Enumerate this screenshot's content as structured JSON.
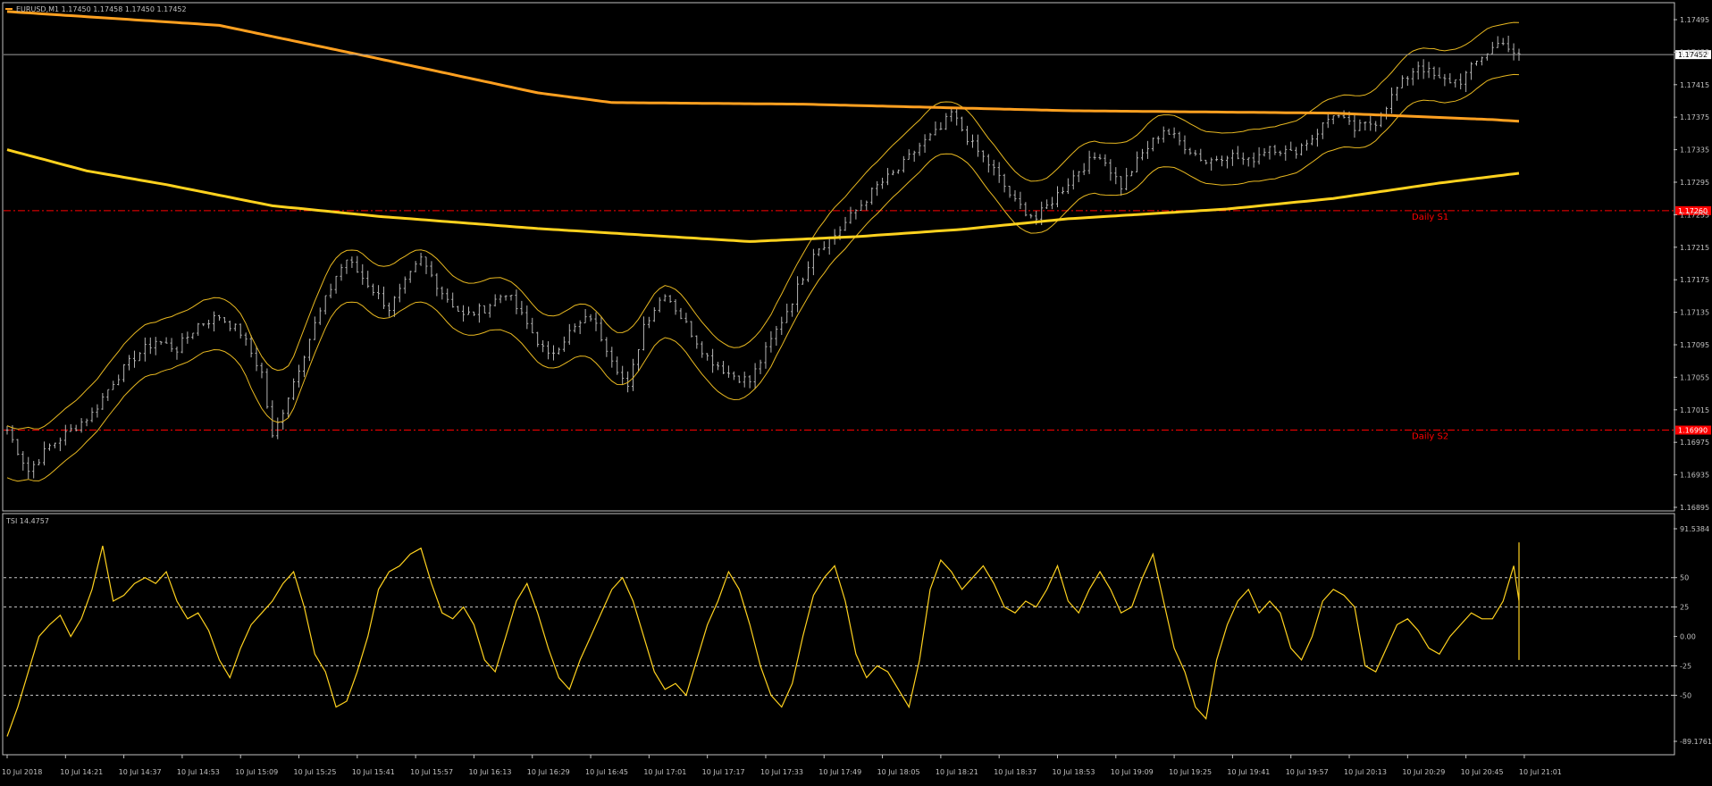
{
  "window": {
    "symbol_info": "EURUSD,M1  1.17450 1.17458 1.17450 1.17452"
  },
  "colors": {
    "background": "#000000",
    "frame": "#c0c0c0",
    "bars": "#b4b4b4",
    "envelope": "#e8b820",
    "ma_upper": "#ffa020",
    "ma_lower": "#ffd21e",
    "pivot": "#ff0000",
    "tsi": "#ffd21e",
    "grid_dash": "#c8c8c8",
    "text": "#c0c0c0"
  },
  "chart_data": [
    {
      "type": "line",
      "chart": "price",
      "title": "EURUSD,M1  1.17450 1.17458 1.17450 1.17452",
      "y_ticks": [
        "1.17495",
        "1.17455",
        "1.17415",
        "1.17375",
        "1.17335",
        "1.17295",
        "1.17255",
        "1.17215",
        "1.17175",
        "1.17135",
        "1.17095",
        "1.17055",
        "1.17015",
        "1.16975",
        "1.16935",
        "1.16895"
      ],
      "ylim": [
        1.16895,
        1.17495
      ],
      "x_ticks": [
        "10 Jul 2018",
        "10 Jul 14:21",
        "10 Jul 14:37",
        "10 Jul 14:53",
        "10 Jul 15:09",
        "10 Jul 15:25",
        "10 Jul 15:41",
        "10 Jul 15:57",
        "10 Jul 16:13",
        "10 Jul 16:29",
        "10 Jul 16:45",
        "10 Jul 17:01",
        "10 Jul 17:17",
        "10 Jul 17:33",
        "10 Jul 17:49",
        "10 Jul 18:05",
        "10 Jul 18:21",
        "10 Jul 18:37",
        "10 Jul 18:53",
        "10 Jul 19:09",
        "10 Jul 19:25",
        "10 Jul 19:41",
        "10 Jul 19:57",
        "10 Jul 20:13",
        "10 Jul 20:29",
        "10 Jul 20:45",
        "10 Jul 21:01"
      ],
      "current_price": {
        "label": "1.17452",
        "value": 1.17452
      },
      "pivots": [
        {
          "name": "Daily S1",
          "value": 1.1726,
          "label": "1.17260"
        },
        {
          "name": "Daily S2",
          "value": 1.1699,
          "label": "1.16990"
        }
      ],
      "close_points": [
        [
          0,
          1.1699
        ],
        [
          4,
          1.1694
        ],
        [
          8,
          1.1697
        ],
        [
          12,
          1.1699
        ],
        [
          16,
          1.1701
        ],
        [
          20,
          1.1705
        ],
        [
          24,
          1.1708
        ],
        [
          28,
          1.171
        ],
        [
          32,
          1.1709
        ],
        [
          36,
          1.1712
        ],
        [
          40,
          1.1713
        ],
        [
          44,
          1.1711
        ],
        [
          48,
          1.1706
        ],
        [
          50,
          1.1698
        ],
        [
          54,
          1.1705
        ],
        [
          58,
          1.1712
        ],
        [
          62,
          1.1718
        ],
        [
          64,
          1.172
        ],
        [
          68,
          1.1717
        ],
        [
          72,
          1.1714
        ],
        [
          76,
          1.1718
        ],
        [
          78,
          1.172
        ],
        [
          82,
          1.1716
        ],
        [
          86,
          1.1713
        ],
        [
          90,
          1.1714
        ],
        [
          94,
          1.1716
        ],
        [
          98,
          1.1712
        ],
        [
          102,
          1.1708
        ],
        [
          106,
          1.1711
        ],
        [
          110,
          1.1713
        ],
        [
          114,
          1.1708
        ],
        [
          117,
          1.1704
        ],
        [
          120,
          1.1712
        ],
        [
          124,
          1.1716
        ],
        [
          128,
          1.1712
        ],
        [
          132,
          1.1708
        ],
        [
          136,
          1.1706
        ],
        [
          140,
          1.1705
        ],
        [
          144,
          1.171
        ],
        [
          148,
          1.1715
        ],
        [
          152,
          1.1721
        ],
        [
          156,
          1.1723
        ],
        [
          160,
          1.1726
        ],
        [
          164,
          1.1729
        ],
        [
          168,
          1.1731
        ],
        [
          172,
          1.1734
        ],
        [
          176,
          1.1736
        ],
        [
          178,
          1.1738
        ],
        [
          182,
          1.1734
        ],
        [
          186,
          1.1731
        ],
        [
          190,
          1.1727
        ],
        [
          194,
          1.1725
        ],
        [
          198,
          1.1728
        ],
        [
          202,
          1.1731
        ],
        [
          206,
          1.1733
        ],
        [
          210,
          1.1729
        ],
        [
          214,
          1.1733
        ],
        [
          218,
          1.1736
        ],
        [
          222,
          1.1734
        ],
        [
          226,
          1.1732
        ],
        [
          230,
          1.1733
        ],
        [
          234,
          1.1732
        ],
        [
          238,
          1.1734
        ],
        [
          242,
          1.1733
        ],
        [
          246,
          1.1735
        ],
        [
          250,
          1.1738
        ],
        [
          254,
          1.1736
        ],
        [
          258,
          1.1737
        ],
        [
          262,
          1.1741
        ],
        [
          266,
          1.1744
        ],
        [
          270,
          1.1742
        ],
        [
          274,
          1.1742
        ],
        [
          278,
          1.1745
        ],
        [
          282,
          1.1747
        ],
        [
          284,
          1.1745
        ]
      ],
      "envelope_offset": 0.00032,
      "series": [
        {
          "type": "line",
          "points": [
            [
              0,
              1.17505
            ],
            [
              40,
              1.17488
            ],
            [
              70,
              1.17447
            ],
            [
              100,
              1.17405
            ],
            [
              114,
              1.17393
            ],
            [
              150,
              1.17391
            ],
            [
              200,
              1.17383
            ],
            [
              250,
              1.1738
            ],
            [
              280,
              1.17372
            ],
            [
              285,
              1.1737
            ]
          ]
        },
        {
          "type": "line",
          "points": [
            [
              0,
              1.17335
            ],
            [
              15,
              1.17309
            ],
            [
              30,
              1.17292
            ],
            [
              50,
              1.17266
            ],
            [
              70,
              1.17253
            ],
            [
              100,
              1.17238
            ],
            [
              125,
              1.17228
            ],
            [
              140,
              1.17222
            ],
            [
              160,
              1.17228
            ],
            [
              180,
              1.17237
            ],
            [
              200,
              1.1725
            ],
            [
              230,
              1.17262
            ],
            [
              250,
              1.17275
            ],
            [
              270,
              1.17294
            ],
            [
              285,
              1.17306
            ]
          ]
        },
        {
          "type": "line",
          "name": "TSI",
          "values_sampled_every_2_bars": [
            -85,
            -60,
            -30,
            0,
            10,
            18,
            0,
            15,
            40,
            77,
            30,
            35,
            45,
            50,
            45,
            55,
            30,
            15,
            20,
            5,
            -20,
            -35,
            -10,
            10,
            20,
            30,
            45,
            55,
            25,
            -15,
            -30,
            -60,
            -55,
            -30,
            0,
            40,
            55,
            60,
            70,
            75,
            45,
            20,
            15,
            25,
            10,
            -20,
            -30,
            0,
            30,
            45,
            20,
            -10,
            -35,
            -45,
            -20,
            0,
            20,
            40,
            50,
            30,
            0,
            -30,
            -45,
            -40,
            -50,
            -20,
            10,
            30,
            55,
            40,
            10,
            -25,
            -50,
            -60,
            -40,
            0,
            35,
            50,
            60,
            30,
            -15,
            -35,
            -25,
            -30,
            -45,
            -60,
            -20,
            40,
            65,
            55,
            40,
            50,
            60,
            45,
            25,
            20,
            30,
            25,
            40,
            60,
            30,
            20,
            40,
            55,
            40,
            20,
            25,
            50,
            70,
            30,
            -10,
            -30,
            -60,
            -70,
            -20,
            10,
            30,
            40,
            20,
            30,
            20,
            -10,
            -20,
            0,
            30,
            40,
            35,
            25,
            -25,
            -30,
            -10,
            10,
            15,
            5,
            -10,
            -15,
            0,
            10,
            20,
            15,
            15,
            30,
            60,
            30,
            0,
            -10,
            -20,
            -5,
            20,
            40,
            55,
            60,
            20,
            -15,
            -20,
            -10,
            0,
            15,
            55,
            80,
            60,
            20,
            15
          ],
          "y_ticks": [
            "91.5384",
            "50",
            "25",
            "0.00",
            "-25",
            "-50",
            "-89.1761"
          ],
          "ylim": [
            -89.1761,
            91.5384
          ]
        }
      ]
    },
    {
      "type": "line",
      "chart": "TSI",
      "title": "TSI 14.4757",
      "y_ticks": [
        "91.5384",
        "50",
        "25",
        "0.00",
        "-25",
        "-50",
        "-89.1761"
      ],
      "ylim": [
        -89.1761,
        91.5384
      ],
      "levels": [
        50,
        25,
        -25,
        -50
      ]
    }
  ]
}
